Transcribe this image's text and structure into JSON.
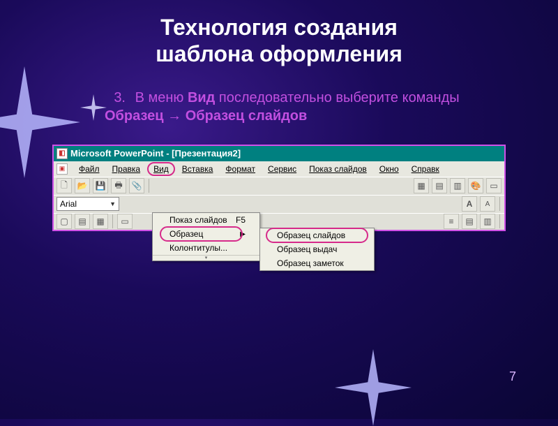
{
  "slide": {
    "title_line1": "Технология создания",
    "title_line2": "шаблона оформления",
    "step_number": "3.",
    "instruction_pre": "В меню ",
    "instruction_b1": "Вид",
    "instruction_mid": " последовательно выберите команды ",
    "instruction_b2": "Образец",
    "instruction_arrow": " → ",
    "instruction_b3": "Образец слайдов",
    "page_number": "7"
  },
  "app": {
    "title": "Microsoft PowerPoint - [Презентация2]",
    "menu": {
      "file": "Файл",
      "edit": "Правка",
      "view": "Вид",
      "insert": "Вставка",
      "format": "Формат",
      "tools": "Сервис",
      "slideshow": "Показ слайдов",
      "window": "Окно",
      "help": "Справк"
    },
    "font": "Arial",
    "view_menu": {
      "slideshow": "Показ слайдов",
      "slideshow_sc": "F5",
      "master": "Образец",
      "headers": "Колонтитулы..."
    },
    "master_submenu": {
      "slide_master": "Образец слайдов",
      "handout_master": "Образец выдач",
      "notes_master": "Образец заметок"
    },
    "labels": {
      "bigA": "A",
      "smallA": "A"
    }
  }
}
